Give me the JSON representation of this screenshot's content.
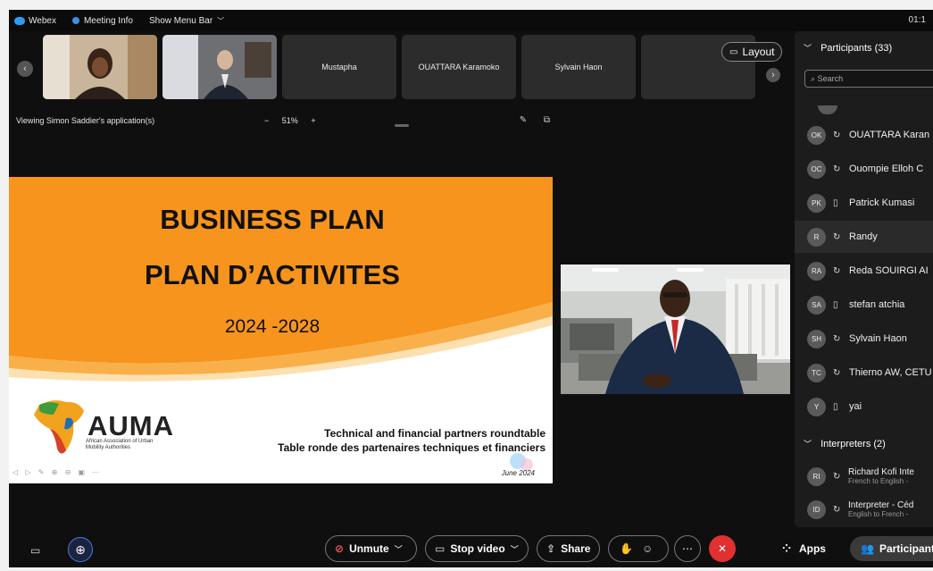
{
  "menubar": {
    "app_name": "Webex",
    "meeting_info": "Meeting Info",
    "show_menu_bar": "Show Menu Bar",
    "clock": "01:1"
  },
  "filmstrip": {
    "tiles": [
      {
        "name": ""
      },
      {
        "name": ""
      },
      {
        "name": "Mustapha"
      },
      {
        "name": "OUATTARA Karamoko"
      },
      {
        "name": "Sylvain Haon"
      },
      {
        "name": ""
      }
    ],
    "layout_label": "Layout"
  },
  "viewbar": {
    "label": "Viewing Simon Saddier's application(s)",
    "zoom_minus": "−",
    "zoom_value": "51%",
    "zoom_plus": "+"
  },
  "slide": {
    "title1": "BUSINESS PLAN",
    "title2": "PLAN D’ACTIVITES",
    "years": "2024 -2028",
    "logo": "AUMA",
    "logo_sub1": "African Association of Urban",
    "logo_sub2": "Mobility Authorities",
    "roundtable_en": "Technical and financial partners roundtable",
    "roundtable_fr": "Table ronde des partenaires techniques et financiers",
    "date": "June 2024"
  },
  "participants": {
    "header": "Participants (33)",
    "search_placeholder": "Search",
    "list": [
      {
        "initials": "OK",
        "name": "OUATTARA Karan",
        "device": "phone",
        "selected": false
      },
      {
        "initials": "OC",
        "name": "Ouompie Elloh C",
        "device": "phone",
        "selected": false
      },
      {
        "initials": "PK",
        "name": "Patrick Kumasi",
        "device": "mobile",
        "selected": false
      },
      {
        "initials": "R",
        "name": "Randy",
        "device": "phone",
        "selected": true
      },
      {
        "initials": "RA",
        "name": "Reda SOUIRGI AI",
        "device": "phone",
        "selected": false
      },
      {
        "initials": "SA",
        "name": "stefan atchia",
        "device": "mobile",
        "selected": false
      },
      {
        "initials": "SH",
        "name": "Sylvain Haon",
        "device": "phone",
        "selected": false
      },
      {
        "initials": "TC",
        "name": "Thierno AW, CETU",
        "device": "phone",
        "selected": false
      },
      {
        "initials": "Y",
        "name": "yai",
        "device": "mobile",
        "selected": false
      }
    ],
    "interpreters_header": "Interpreters (2)",
    "interpreters": [
      {
        "initials": "RI",
        "name": "Richard Kofi Inte",
        "langs": "French to English -"
      },
      {
        "initials": "ID",
        "name": "Interpreter - Céd",
        "langs": "English to French -"
      }
    ]
  },
  "controls": {
    "unmute": "Unmute",
    "stop_video": "Stop video",
    "share": "Share",
    "apps": "Apps",
    "participants": "Participants"
  }
}
